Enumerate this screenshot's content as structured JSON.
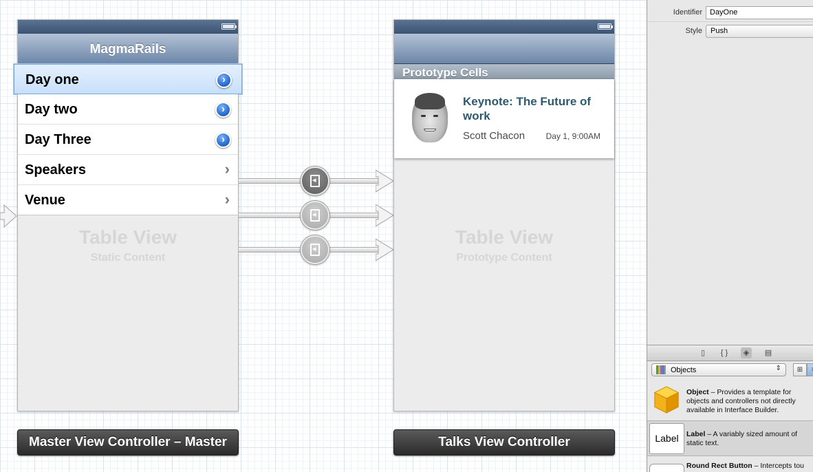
{
  "master_scene": {
    "nav_title": "MagmaRails",
    "cells": [
      {
        "label": "Day one",
        "accessory": "detail-disclosure",
        "selected": true
      },
      {
        "label": "Day two",
        "accessory": "detail-disclosure",
        "selected": false
      },
      {
        "label": "Day Three",
        "accessory": "detail-disclosure",
        "selected": false
      },
      {
        "label": "Speakers",
        "accessory": "chevron",
        "selected": false
      },
      {
        "label": "Venue",
        "accessory": "chevron",
        "selected": false
      }
    ],
    "disclosure_glyph": "›",
    "chevron_glyph": "›",
    "placeholder_title": "Table View",
    "placeholder_subtitle": "Static Content",
    "dock_label": "Master View Controller – Master"
  },
  "talks_scene": {
    "nav_title": "",
    "section_header": "Prototype Cells",
    "cell": {
      "title": "Keynote: The Future of work",
      "speaker": "Scott Chacon",
      "time": "Day 1, 9:00AM"
    },
    "placeholder_title": "Table View",
    "placeholder_subtitle": "Prototype Content",
    "dock_label": "Talks View Controller"
  },
  "segues": [
    {
      "style": "push",
      "selected": true,
      "color": "#6f6f6f"
    },
    {
      "style": "push",
      "selected": false,
      "color": "#b5b5b5"
    },
    {
      "style": "push",
      "selected": false,
      "color": "#b5b5b5"
    }
  ],
  "inspector": {
    "identifier_label": "Identifier",
    "identifier_value": "DayOne",
    "style_label": "Style",
    "style_value": "Push"
  },
  "library": {
    "tabs": [
      "file-icon",
      "braces-icon",
      "cube-icon",
      "media-icon"
    ],
    "filter_value": "Objects",
    "items": [
      {
        "name": "Object",
        "description": " – Provides a template for objects and controllers not directly available in Interface Builder."
      },
      {
        "name": "Label",
        "description": " – A variably sized amount of static text.",
        "thumb": "Label"
      },
      {
        "name": "Round Rect Button",
        "description": " – Intercepts tou"
      }
    ]
  },
  "colors": {
    "nav_bar": "#8fa4bf",
    "title_text": "#2e5a6e",
    "selection": "#c9e0fa"
  }
}
